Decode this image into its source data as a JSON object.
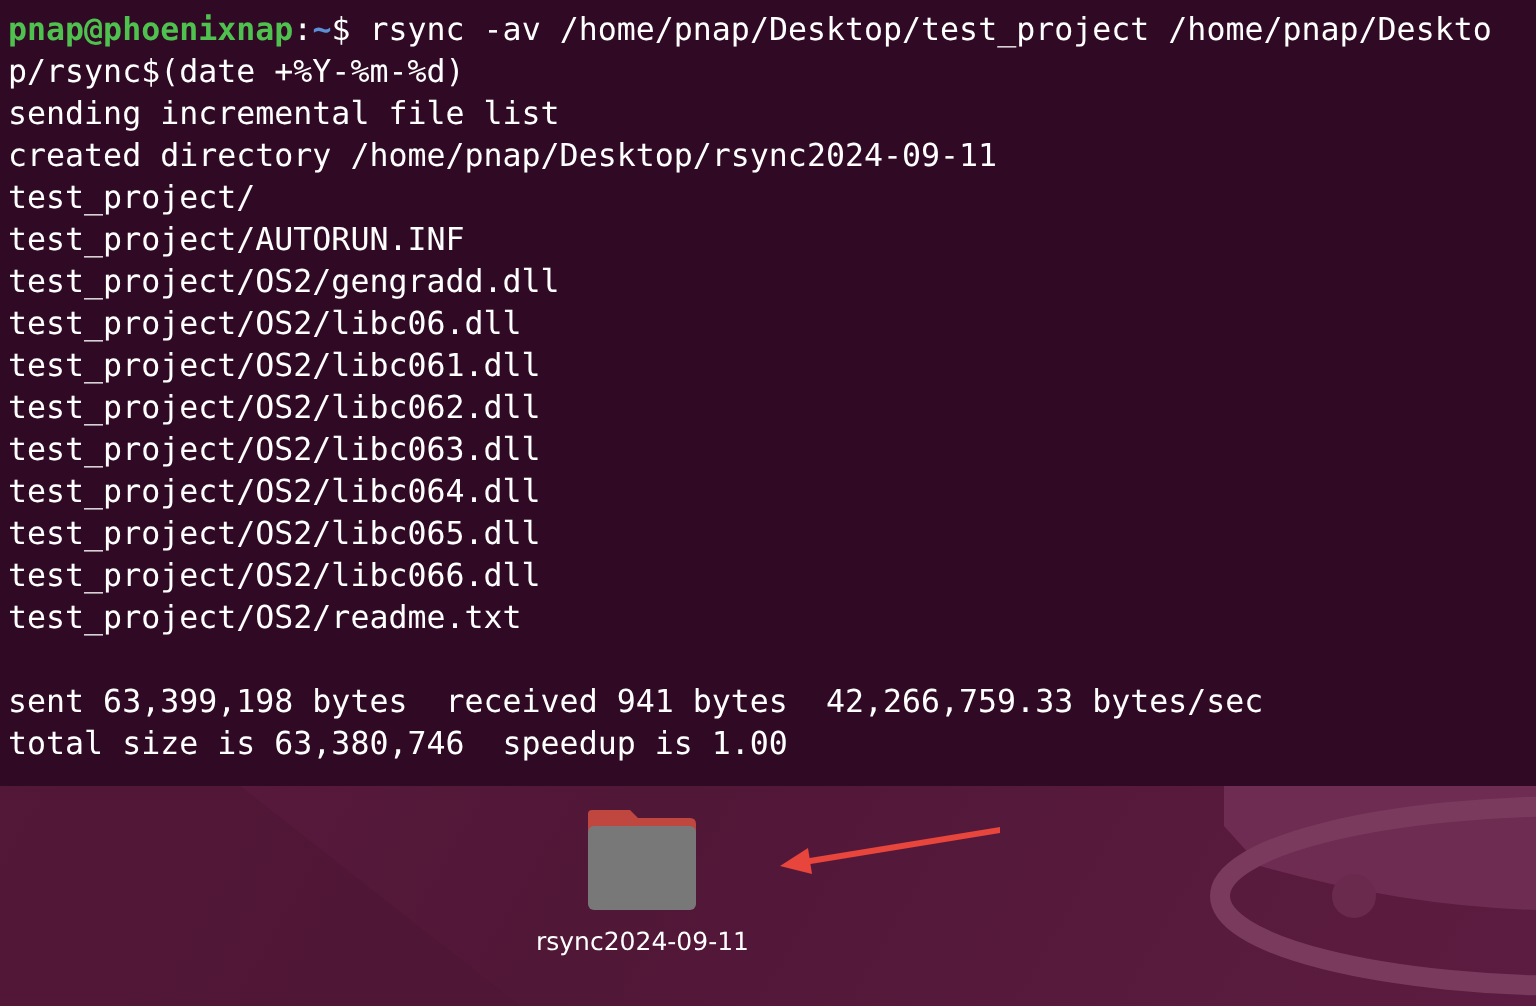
{
  "terminal": {
    "prompt": {
      "user_host": "pnap@phoenixnap",
      "separator": ":",
      "path": "~",
      "symbol": "$"
    },
    "command_lines": [
      "rsync -av /home/pnap/Desktop/test_project /home/pnap/Deskto",
      "p/rsync$(date +%Y-%m-%d)"
    ],
    "output": [
      "sending incremental file list",
      "created directory /home/pnap/Desktop/rsync2024-09-11",
      "test_project/",
      "test_project/AUTORUN.INF",
      "test_project/OS2/gengradd.dll",
      "test_project/OS2/libc06.dll",
      "test_project/OS2/libc061.dll",
      "test_project/OS2/libc062.dll",
      "test_project/OS2/libc063.dll",
      "test_project/OS2/libc064.dll",
      "test_project/OS2/libc065.dll",
      "test_project/OS2/libc066.dll",
      "test_project/OS2/readme.txt"
    ],
    "summary": [
      "sent 63,399,198 bytes  received 941 bytes  42,266,759.33 bytes/sec",
      "total size is 63,380,746  speedup is 1.00"
    ]
  },
  "desktop": {
    "icons": [
      {
        "label": "rsync2024-09-11"
      }
    ]
  }
}
